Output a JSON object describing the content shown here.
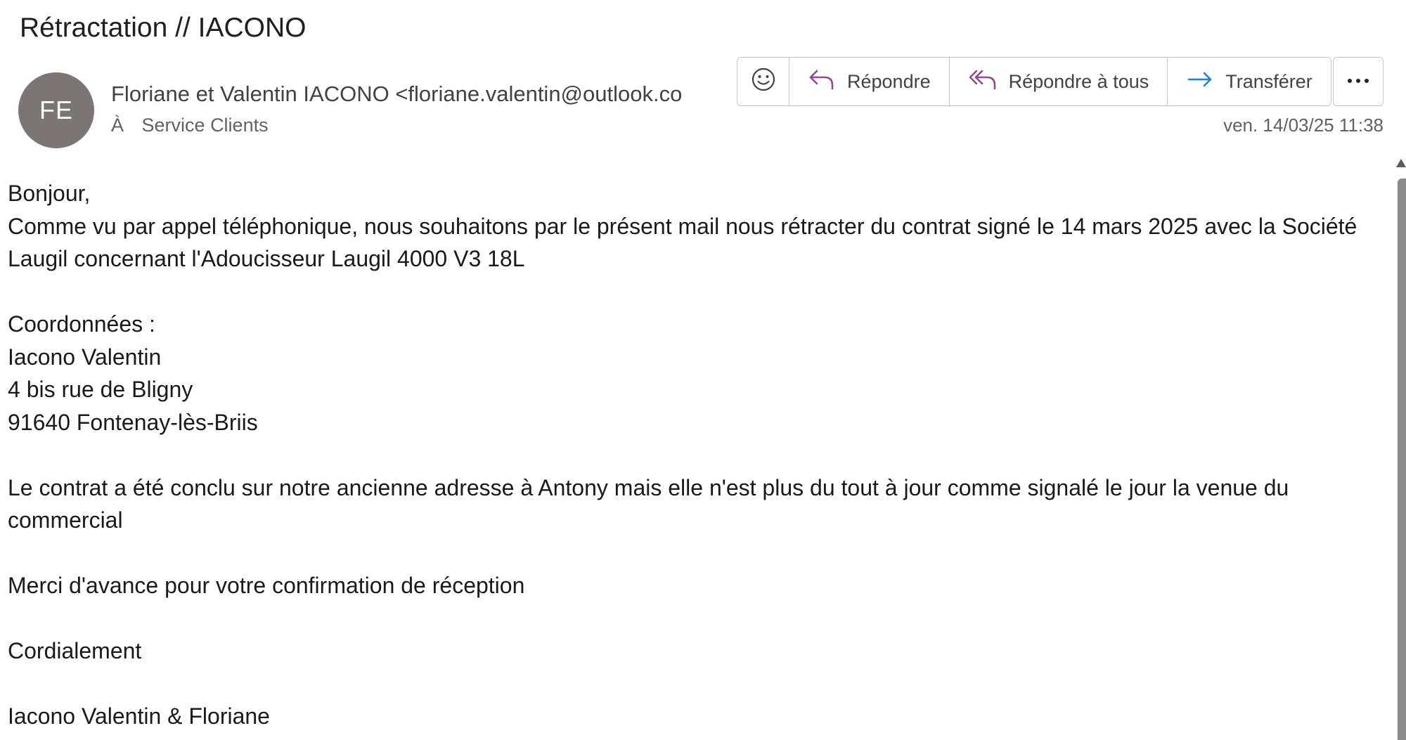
{
  "message": {
    "subject": "Rétractation //  IACONO",
    "avatar_initials": "FE",
    "sender": "Floriane et Valentin IACONO <floriane.valentin@outlook.co",
    "to_label": "À",
    "recipient": "Service Clients",
    "date": "ven. 14/03/25 11:38"
  },
  "toolbar": {
    "emoji_icon": "smiley-icon",
    "reply_label": "Répondre",
    "reply_all_label": "Répondre à tous",
    "forward_label": "Transférer",
    "more_icon": "ellipsis-icon"
  },
  "body": {
    "lines": [
      "Bonjour,",
      "Comme vu par appel téléphonique, nous souhaitons par le présent mail nous rétracter du contrat signé le 14 mars 2025 avec la Société Laugil concernant l'Adoucisseur Laugil 4000 V3 18L",
      "",
      "Coordonnées :",
      "Iacono Valentin",
      "4 bis rue de Bligny",
      "91640 Fontenay-lès-Briis",
      "",
      "Le contrat a été conclu sur notre ancienne adresse à Antony mais elle n'est plus du tout à jour comme signalé le jour la venue du commercial",
      "",
      "Merci d'avance pour votre confirmation de réception",
      "",
      "Cordialement",
      "",
      "Iacono Valentin & Floriane"
    ]
  },
  "colors": {
    "avatar_bg": "#7b7574",
    "reply_icon": "#8f4a8c",
    "forward_icon": "#1f7fd0",
    "border": "#c7c7c7"
  }
}
